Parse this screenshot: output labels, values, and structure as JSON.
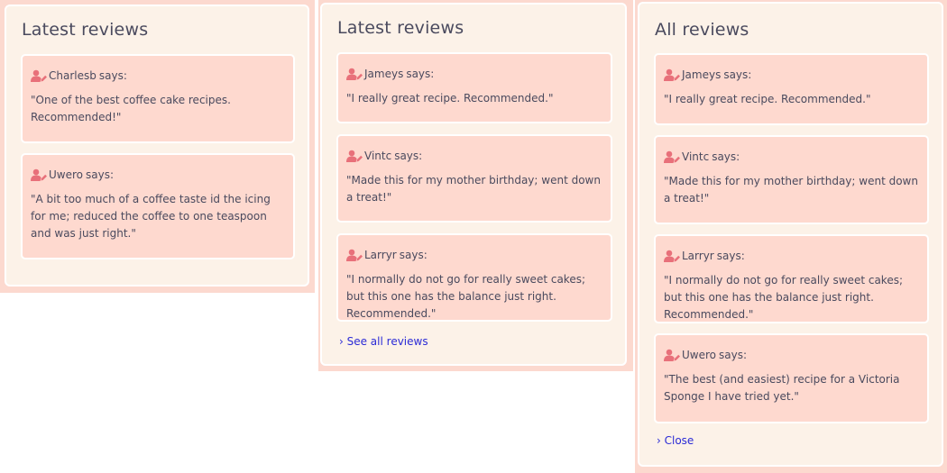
{
  "says_label": "says:",
  "panels": [
    {
      "title": "Latest reviews",
      "reviews": [
        {
          "author": "Charlesb",
          "text": "\"One of the best coffee cake recipes. Recommended!\""
        },
        {
          "author": "Uwero",
          "text": "\"A bit too much of a coffee taste id the icing for me; reduced the coffee to one teaspoon and was just right.\""
        }
      ]
    },
    {
      "title": "Latest reviews",
      "reviews": [
        {
          "author": "Jameys",
          "text": "\"I really great recipe. Recommended.\""
        },
        {
          "author": "Vintc",
          "text": "\"Made this for my mother birthday; went down a treat!\""
        },
        {
          "author": "Larryr",
          "text": "\"I normally do not go for really sweet cakes; but this one has the balance just right. Recommended.\""
        }
      ],
      "link": "› See all reviews"
    },
    {
      "title": "All reviews",
      "reviews": [
        {
          "author": "Jameys",
          "text": "\"I really great recipe. Recommended.\""
        },
        {
          "author": "Vintc",
          "text": "\"Made this for my mother birthday; went down a treat!\""
        },
        {
          "author": "Larryr",
          "text": "\"I normally do not go for really sweet cakes; but this one has the balance just right. Recommended.\""
        },
        {
          "author": "Uwero",
          "text": "\"The best (and easiest) recipe for a Victoria Sponge I have tried yet.\""
        }
      ],
      "link": "› Close"
    }
  ],
  "colors": {
    "outer_background": "#fcd9cf",
    "panel_background": "#fcf2e8",
    "card_background": "#fed9cf",
    "icon": "#e8707a",
    "text": "#4a4a5e",
    "link": "#2b2bd6"
  },
  "icons": {
    "review_author": "user-edit-icon"
  }
}
